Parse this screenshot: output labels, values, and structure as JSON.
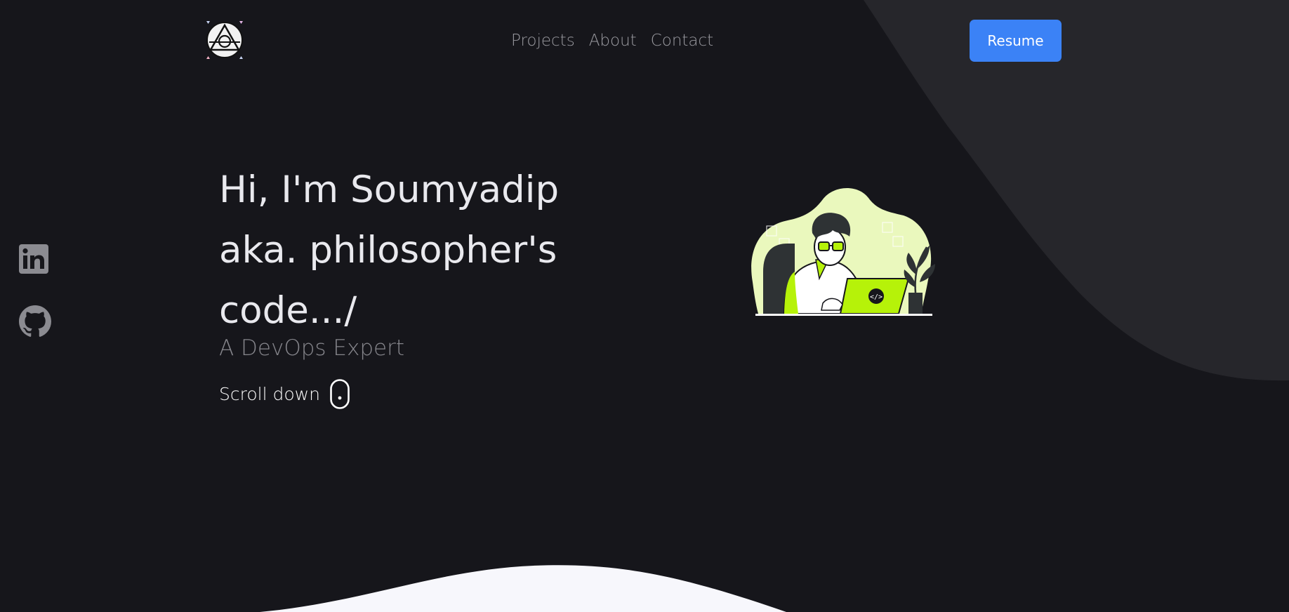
{
  "header": {
    "logo_icon": "philosopher-stone-logo-icon",
    "nav": [
      {
        "label": "Projects"
      },
      {
        "label": "About"
      },
      {
        "label": "Contact"
      }
    ],
    "resume_label": "Resume"
  },
  "social": {
    "linkedin_icon": "linkedin-icon",
    "github_icon": "github-icon"
  },
  "hero": {
    "title_lines": [
      "Hi, I'm Soumyadip",
      "aka. philosopher's",
      "code.../"
    ],
    "subtitle": "A DevOps Expert",
    "scroll_label": "Scroll down",
    "scroll_icon": "mouse-icon",
    "illustration_icon": "developer-at-laptop-illustration"
  },
  "colors": {
    "background": "#16161b",
    "wave_gray": "#26262b",
    "wave_light": "#f7f7fc",
    "accent": "#3b82f6",
    "illustration_lime": "#b6f209"
  }
}
